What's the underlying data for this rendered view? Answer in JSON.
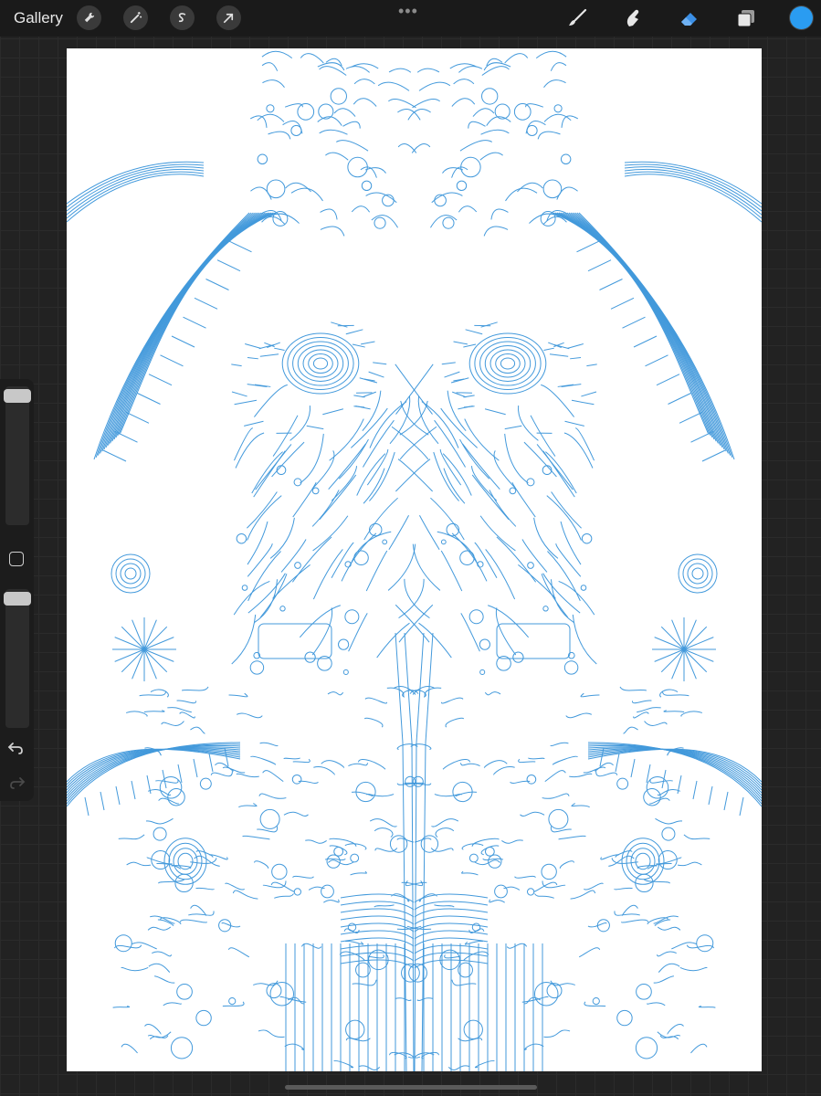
{
  "topbar": {
    "gallery_label": "Gallery",
    "left_tools": [
      {
        "name": "actions",
        "icon": "wrench-icon"
      },
      {
        "name": "adjustments",
        "icon": "magic-wand-icon"
      },
      {
        "name": "selection",
        "icon": "selection-s-icon"
      },
      {
        "name": "transform",
        "icon": "arrow-cursor-icon"
      }
    ],
    "more_label": "•••",
    "right_tools": [
      {
        "name": "brush",
        "icon": "brush-icon"
      },
      {
        "name": "smudge",
        "icon": "smudge-finger-icon"
      },
      {
        "name": "eraser",
        "icon": "eraser-icon",
        "active": true
      },
      {
        "name": "layers",
        "icon": "layers-icon"
      }
    ],
    "current_color": "#2a9cf1"
  },
  "sidebar": {
    "brush_size_icon": "slider-icon",
    "opacity_icon": "slider-icon",
    "modify_icon": "square-icon",
    "undo_icon": "undo-icon",
    "redo_icon": "redo-icon"
  },
  "canvas": {
    "background": "#ffffff",
    "line_color": "#2f8fd8",
    "artwork": "symmetrical-line-art"
  }
}
